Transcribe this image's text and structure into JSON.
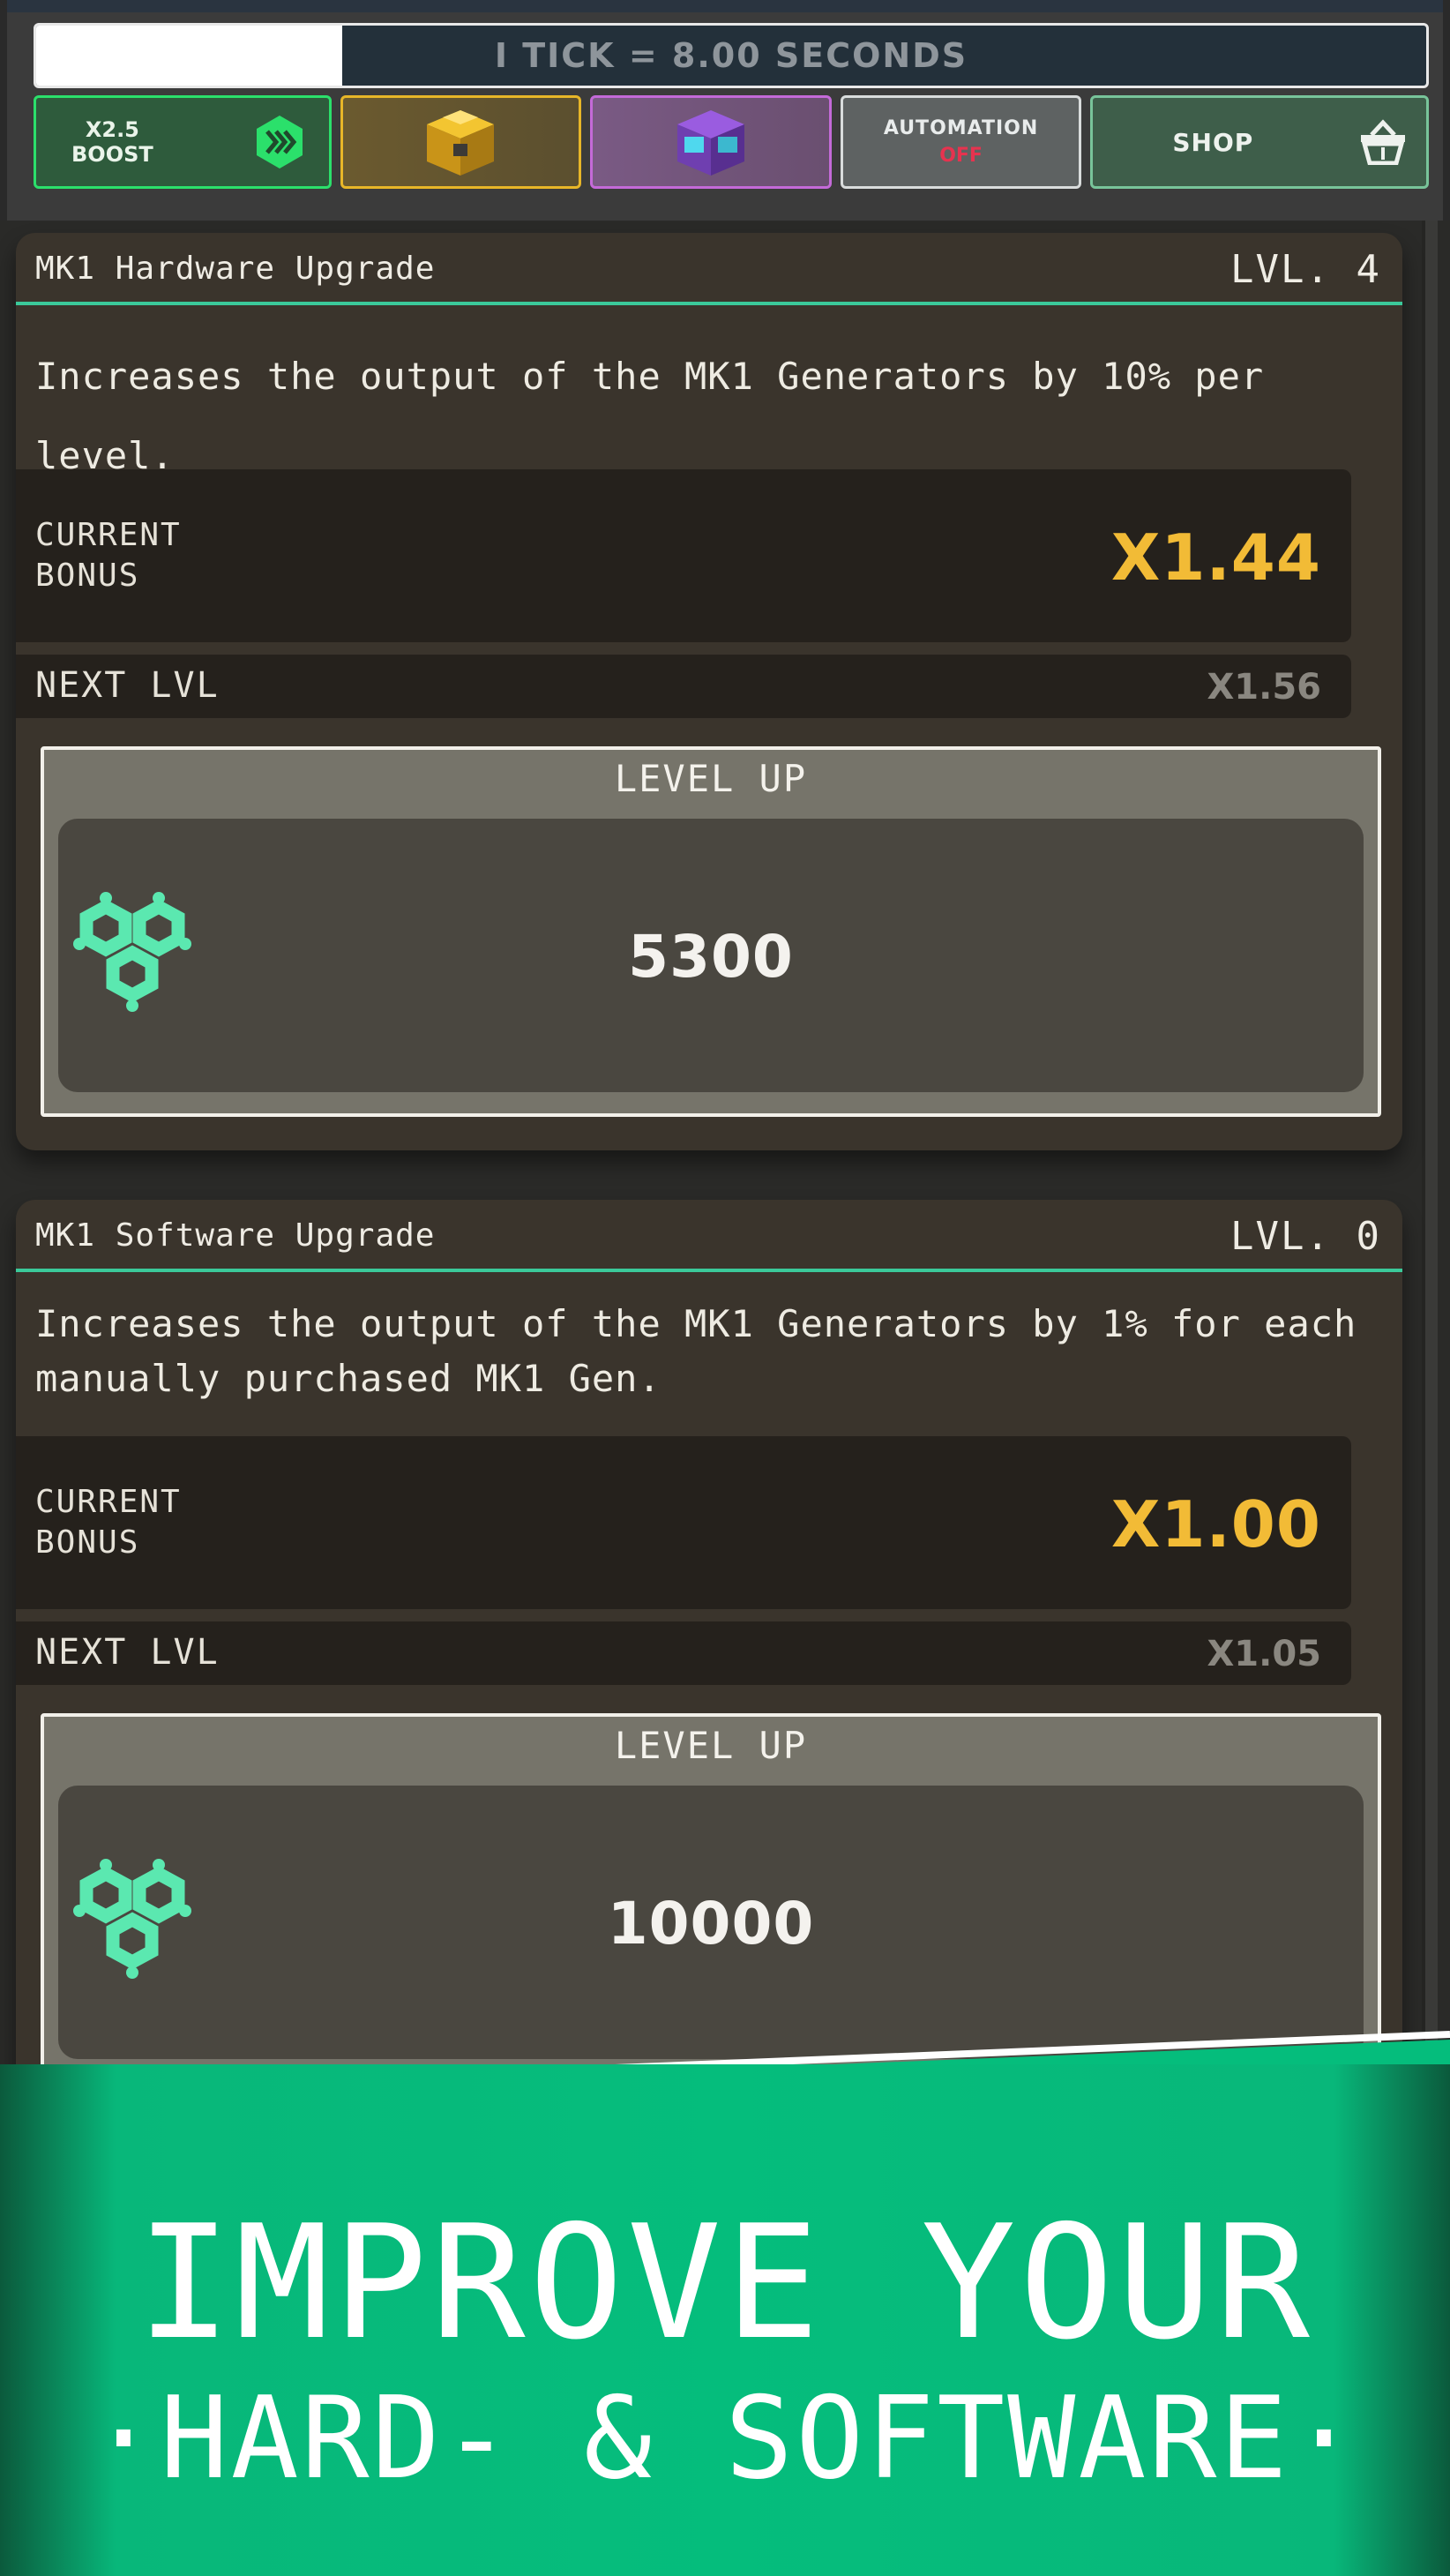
{
  "header": {
    "tick_text": "I TICK = 8.00 SECONDS",
    "tick_progress": 0.22,
    "boost": {
      "label_line1": "X2.5",
      "label_line2": "BOOST",
      "icon": "fast-forward-hex-icon"
    },
    "chest_gold": {
      "icon": "gold-chest-icon"
    },
    "chest_purple": {
      "icon": "purple-chest-icon"
    },
    "automation": {
      "label": "AUTOMATION",
      "state": "OFF"
    },
    "shop": {
      "label": "SHOP",
      "icon": "basket-icon"
    }
  },
  "upgrades": [
    {
      "title": "MK1 Hardware Upgrade",
      "level": "LVL. 4",
      "description": "Increases the output of the MK1 Generators by 10% per level.",
      "current_label_line1": "CURRENT",
      "current_label_line2": "BONUS",
      "current_value": "X1.44",
      "next_label": "NEXT LVL",
      "next_value": "X1.56",
      "levelup_title": "LEVEL UP",
      "cost": "5300",
      "cost_icon": "hexagon-cluster-icon"
    },
    {
      "title": "MK1 Software Upgrade",
      "level": "LVL. 0",
      "description": "Increases the output of the MK1 Generators by 1% for each manually purchased MK1 Gen.",
      "current_label_line1": "CURRENT",
      "current_label_line2": "BONUS",
      "current_value": "X1.00",
      "next_label": "NEXT LVL",
      "next_value": "X1.05",
      "levelup_title": "LEVEL UP",
      "cost": "10000",
      "cost_icon": "hexagon-cluster-icon"
    }
  ],
  "promo": {
    "line1": "IMPROVE YOUR",
    "line2": "·HARD- & SOFTWARE·"
  },
  "colors": {
    "accent_green": "#3bc99a",
    "bonus_gold": "#f2bb36",
    "automation_off": "#e6334f",
    "promo_green": "#05bd7c"
  }
}
